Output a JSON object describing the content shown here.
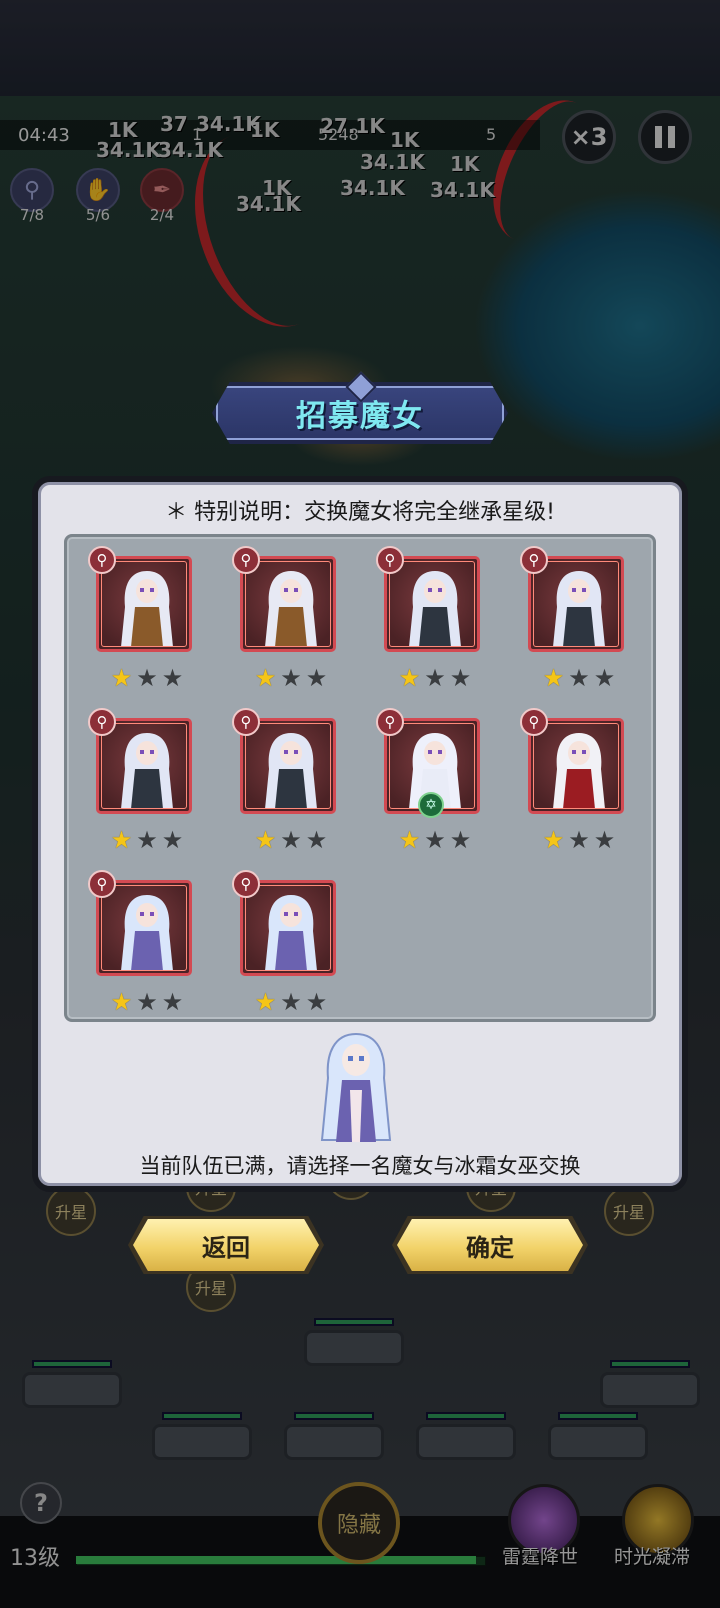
{
  "hud": {
    "timer": "04:43",
    "stat_a": "1",
    "stat_b": "5248",
    "stat_c": "5",
    "speed_label": "×3",
    "pause_icon": "pause-icon",
    "damage_numbers": [
      "1K",
      "37",
      "34.1K",
      "27.1K",
      "34.1K",
      "1K",
      "1K",
      "34.1K",
      "1K",
      "34.1K",
      "1K",
      "34.1K",
      "34.1K",
      "34.1K"
    ],
    "skills": [
      {
        "icon": "staff-icon",
        "count": "7/8"
      },
      {
        "icon": "claw-icon",
        "count": "5/6"
      },
      {
        "icon": "feather-icon",
        "count": "2/4"
      }
    ]
  },
  "dialog": {
    "title": "招募魔女",
    "notice": "＊ 特别说明：交换魔女将完全继承星级!",
    "candidate_text": "当前队伍已满，请选择一名魔女与冰霜女巫交换",
    "cards": [
      {
        "name": "armored-witch",
        "class_icon": "staff-icon",
        "stars": 1,
        "max_stars": 3,
        "hair": "#e7e9f4",
        "outfit": "#8a5a2a"
      },
      {
        "name": "armored-witch",
        "class_icon": "staff-icon",
        "stars": 1,
        "max_stars": 3,
        "hair": "#e7e9f4",
        "outfit": "#8a5a2a"
      },
      {
        "name": "trident-witch",
        "class_icon": "staff-icon",
        "stars": 1,
        "max_stars": 3,
        "hair": "#e1e6f5",
        "outfit": "#2d3540"
      },
      {
        "name": "trident-witch",
        "class_icon": "staff-icon",
        "stars": 1,
        "max_stars": 3,
        "hair": "#e1e6f5",
        "outfit": "#2d3540"
      },
      {
        "name": "trident-witch",
        "class_icon": "staff-icon",
        "stars": 1,
        "max_stars": 3,
        "hair": "#e1e6f5",
        "outfit": "#2d3540"
      },
      {
        "name": "trident-witch",
        "class_icon": "staff-icon",
        "stars": 1,
        "max_stars": 3,
        "hair": "#e1e6f5",
        "outfit": "#2d3540"
      },
      {
        "name": "hex-witch",
        "class_icon": "staff-icon",
        "stars": 1,
        "max_stars": 3,
        "hair": "#eef0fb",
        "outfit": "#e9ecf7",
        "emblem": "hexagram-icon"
      },
      {
        "name": "crimson-witch",
        "class_icon": "staff-icon",
        "stars": 1,
        "max_stars": 3,
        "hair": "#f1f1f6",
        "outfit": "#9b1c22"
      },
      {
        "name": "frost-witch",
        "class_icon": "staff-icon",
        "stars": 1,
        "max_stars": 3,
        "hair": "#d9e6fb",
        "outfit": "#6b62b0"
      },
      {
        "name": "frost-witch",
        "class_icon": "staff-icon",
        "stars": 1,
        "max_stars": 3,
        "hair": "#d9e6fb",
        "outfit": "#6b62b0"
      }
    ],
    "back_label": "返回",
    "confirm_label": "确定"
  },
  "team": {
    "upgrade_label": "升星",
    "upgrade_count": 6
  },
  "bottom": {
    "level": "13级",
    "xp_progress": 0.98,
    "help_label": "?",
    "hide_label": "隐藏",
    "ult1_label": "雷霆降世",
    "ult2_label": "时光凝滞"
  },
  "colors": {
    "accent_gold": "#f2d36a",
    "card_border": "#d34a52",
    "star_on": "#f5c517",
    "star_off": "#3a3d40",
    "title_text": "#7fe8f0"
  }
}
